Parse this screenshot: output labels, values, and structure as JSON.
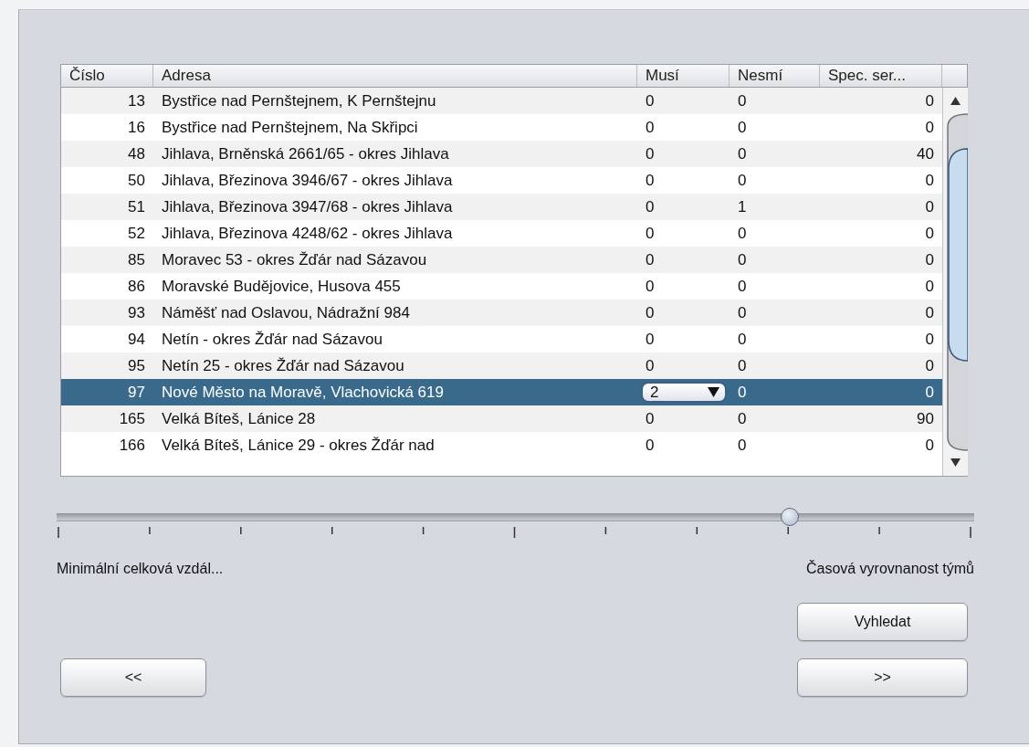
{
  "table": {
    "columns": [
      "Číslo",
      "Adresa",
      "Musí",
      "Nesmí",
      "Spec. ser..."
    ],
    "rows": [
      {
        "cislo": "13",
        "adresa": "Bystřice nad Pernštejnem, K Pernštejnu",
        "musi": "0",
        "nesmi": "0",
        "spec": "0",
        "selected": false,
        "editing": false
      },
      {
        "cislo": "16",
        "adresa": "Bystřice nad Pernštejnem, Na Skřipci",
        "musi": "0",
        "nesmi": "0",
        "spec": "0",
        "selected": false,
        "editing": false
      },
      {
        "cislo": "48",
        "adresa": "Jihlava, Brněnská 2661/65 - okres Jihlava",
        "musi": "0",
        "nesmi": "0",
        "spec": "40",
        "selected": false,
        "editing": false
      },
      {
        "cislo": "50",
        "adresa": "Jihlava, Březinova 3946/67 - okres Jihlava",
        "musi": "0",
        "nesmi": "0",
        "spec": "0",
        "selected": false,
        "editing": false
      },
      {
        "cislo": "51",
        "adresa": "Jihlava, Březinova 3947/68 - okres Jihlava",
        "musi": "0",
        "nesmi": "1",
        "spec": "0",
        "selected": false,
        "editing": false
      },
      {
        "cislo": "52",
        "adresa": "Jihlava, Březinova 4248/62 - okres Jihlava",
        "musi": "0",
        "nesmi": "0",
        "spec": "0",
        "selected": false,
        "editing": false
      },
      {
        "cislo": "85",
        "adresa": "Moravec 53 - okres Žďár nad Sázavou",
        "musi": "0",
        "nesmi": "0",
        "spec": "0",
        "selected": false,
        "editing": false
      },
      {
        "cislo": "86",
        "adresa": "Moravské Budějovice, Husova 455",
        "musi": "0",
        "nesmi": "0",
        "spec": "0",
        "selected": false,
        "editing": false
      },
      {
        "cislo": "93",
        "adresa": "Náměšť nad Oslavou, Nádražní 984",
        "musi": "0",
        "nesmi": "0",
        "spec": "0",
        "selected": false,
        "editing": false
      },
      {
        "cislo": "94",
        "adresa": "Netín - okres Žďár nad Sázavou",
        "musi": "0",
        "nesmi": "0",
        "spec": "0",
        "selected": false,
        "editing": false
      },
      {
        "cislo": "95",
        "adresa": "Netín 25 - okres Žďár nad Sázavou",
        "musi": "0",
        "nesmi": "0",
        "spec": "0",
        "selected": false,
        "editing": false
      },
      {
        "cislo": "97",
        "adresa": "Nové Město na Moravě, Vlachovická 619",
        "musi": "2",
        "nesmi": "0",
        "spec": "0",
        "selected": true,
        "editing": true
      },
      {
        "cislo": "165",
        "adresa": "Velká Bíteš, Lánice 28",
        "musi": "0",
        "nesmi": "0",
        "spec": "90",
        "selected": false,
        "editing": false
      },
      {
        "cislo": "166",
        "adresa": "Velká Bíteš, Lánice 29 - okres Žďár nad",
        "musi": "0",
        "nesmi": "0",
        "spec": "0",
        "selected": false,
        "editing": false
      }
    ]
  },
  "slider": {
    "level": 0.8,
    "left_label": "Minimální celková vzdál...",
    "right_label": "Časová vyrovnanost týmů"
  },
  "buttons": {
    "search": "Vyhledat",
    "back": "<<",
    "next": ">>"
  }
}
